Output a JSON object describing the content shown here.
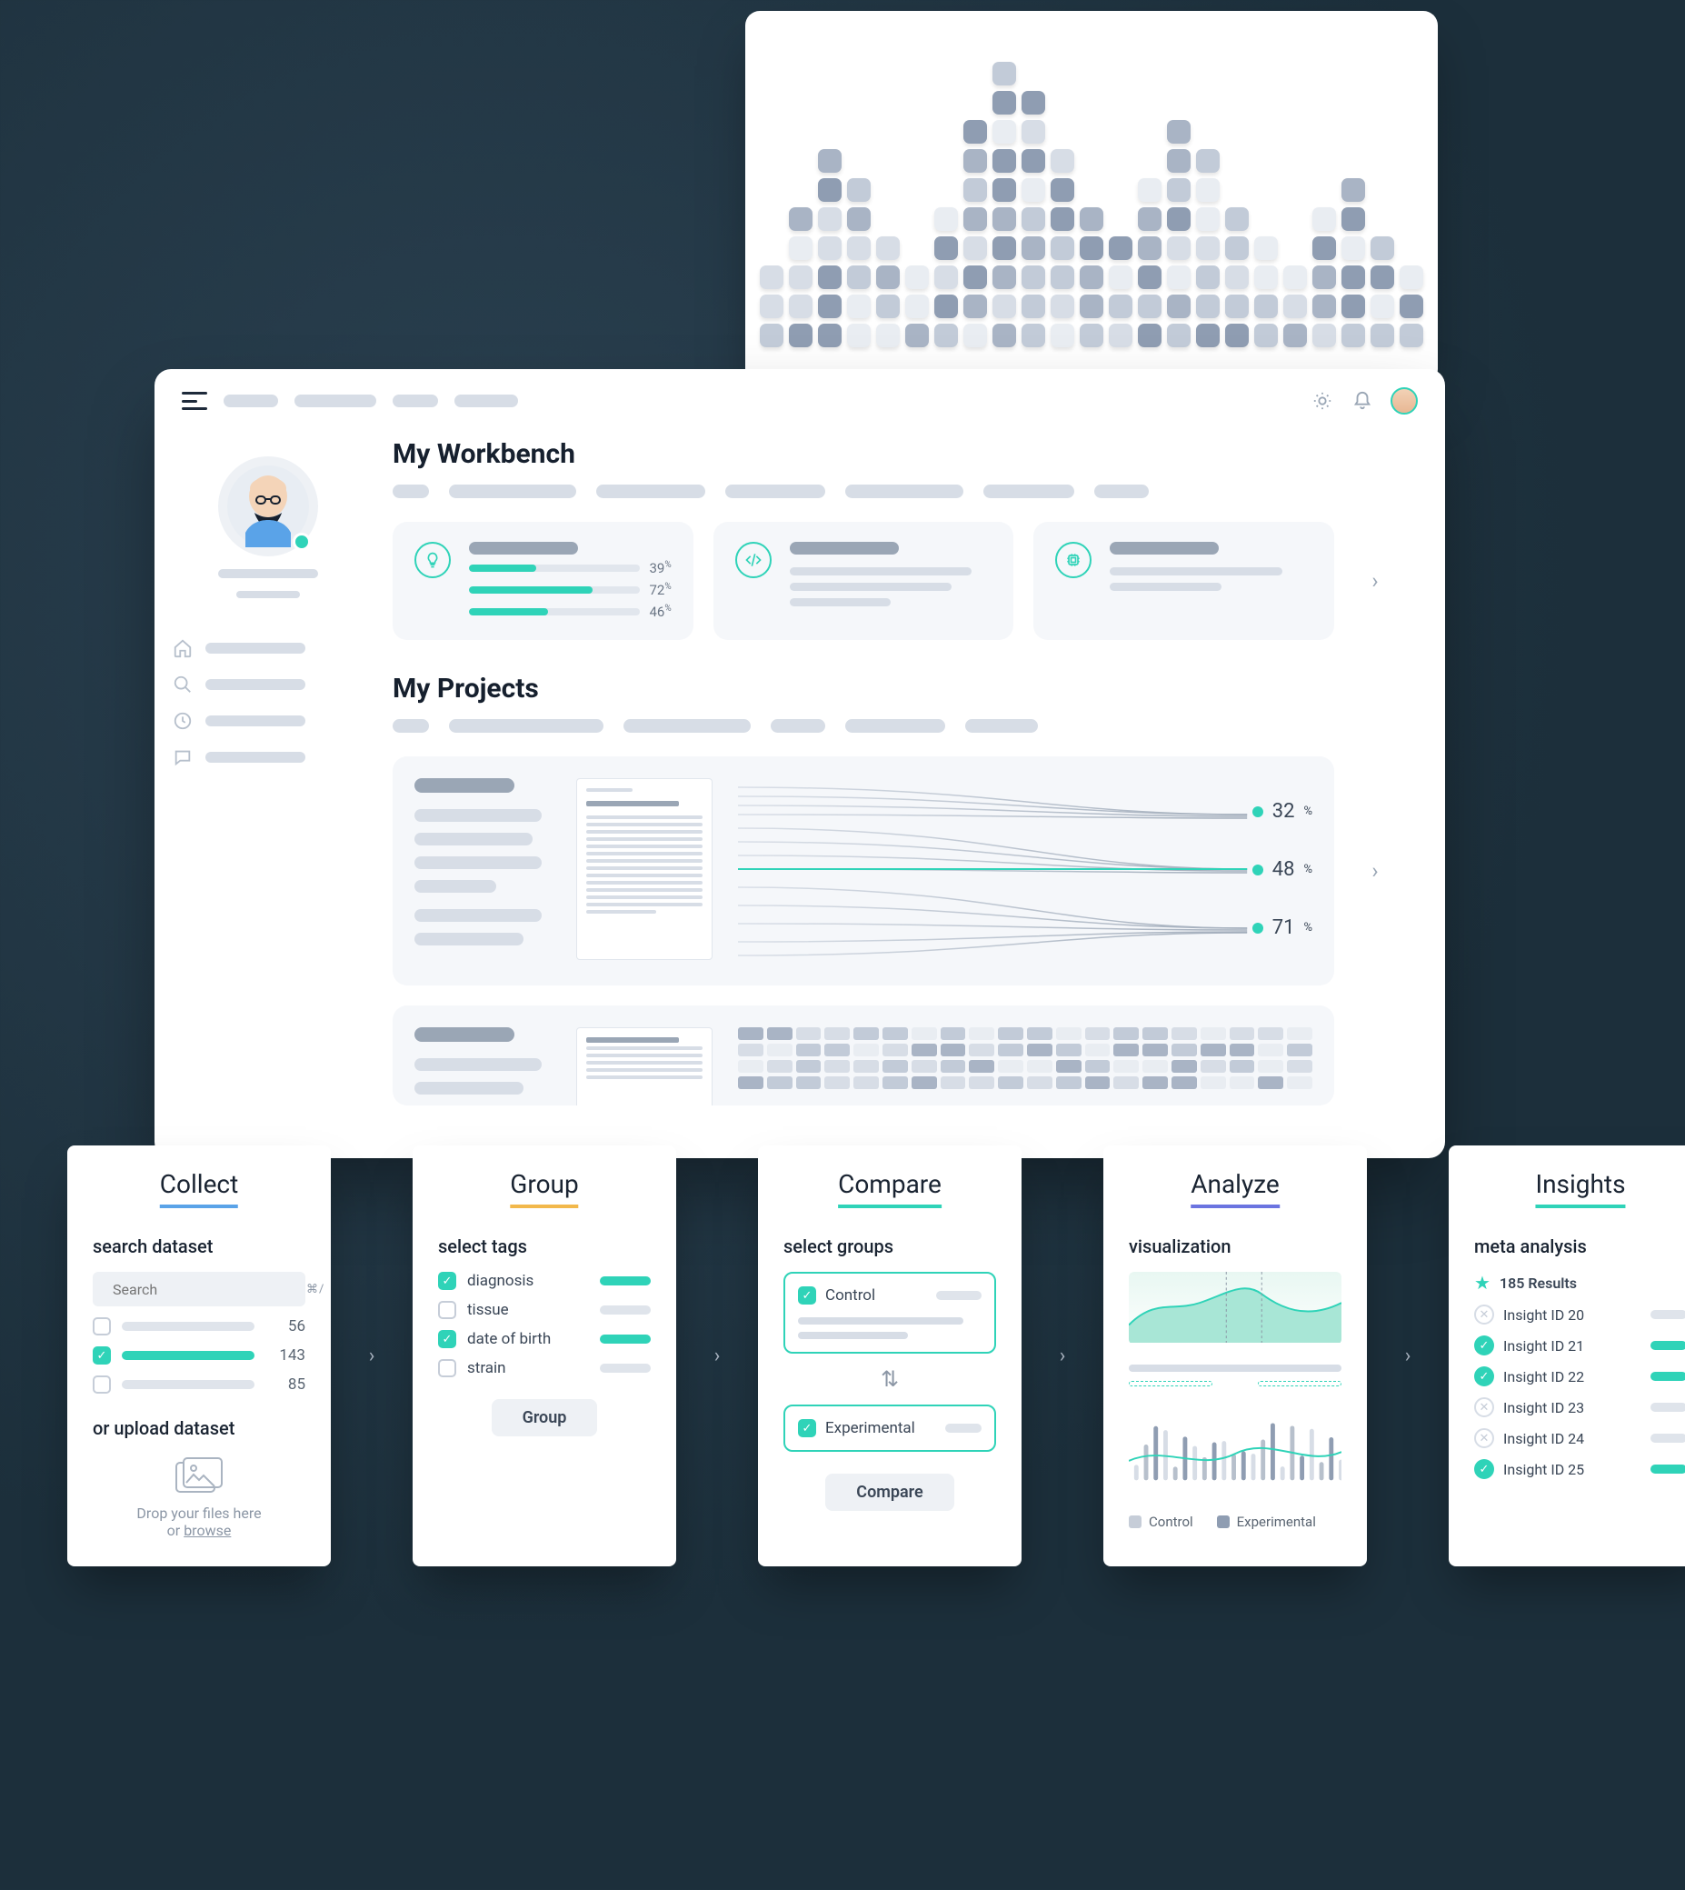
{
  "hero": {
    "columns": [
      3,
      5,
      7,
      6,
      4,
      3,
      5,
      8,
      10,
      9,
      7,
      5,
      4,
      6,
      8,
      7,
      5,
      4,
      3,
      5,
      6,
      4,
      3
    ],
    "palette": [
      "#e9edf2",
      "#d7dde6",
      "#c2cbd8",
      "#a9b4c5",
      "#8f9db2"
    ]
  },
  "app": {
    "workbench_title": "My Workbench",
    "projects_title": "My Projects",
    "stat_cards": [
      {
        "icon": "bulb",
        "bars": [
          {
            "pct": 39,
            "label": "39"
          },
          {
            "pct": 72,
            "label": "72"
          },
          {
            "pct": 46,
            "label": "46"
          }
        ]
      },
      {
        "icon": "code"
      },
      {
        "icon": "chip"
      }
    ],
    "project_metrics": [
      {
        "v": "32"
      },
      {
        "v": "48"
      },
      {
        "v": "71"
      }
    ]
  },
  "wf": {
    "collect": {
      "title": "Collect",
      "sub1": "search dataset",
      "sub2": "or upload dataset",
      "search_placeholder": "Search",
      "shortcut": "⌘/",
      "rows": [
        {
          "checked": false,
          "count": "56"
        },
        {
          "checked": true,
          "count": "143"
        },
        {
          "checked": false,
          "count": "85"
        }
      ],
      "drop_text": "Drop your files here",
      "browse": "browse",
      "or": "or "
    },
    "group": {
      "title": "Group",
      "sub": "select tags",
      "tags": [
        {
          "name": "diagnosis",
          "checked": true
        },
        {
          "name": "tissue",
          "checked": false
        },
        {
          "name": "date of birth",
          "checked": true
        },
        {
          "name": "strain",
          "checked": false
        }
      ],
      "btn": "Group"
    },
    "compare": {
      "title": "Compare",
      "sub": "select groups",
      "g1": "Control",
      "g2": "Experimental",
      "btn": "Compare"
    },
    "analyze": {
      "title": "Analyze",
      "sub": "visualization",
      "legend1": "Control",
      "legend2": "Experimental"
    },
    "insights": {
      "title": "Insights",
      "sub": "meta analysis",
      "results": "185 Results",
      "items": [
        {
          "id": "Insight ID 20",
          "ok": false
        },
        {
          "id": "Insight ID 21",
          "ok": true
        },
        {
          "id": "Insight ID 22",
          "ok": true
        },
        {
          "id": "Insight ID 23",
          "ok": false
        },
        {
          "id": "Insight ID 24",
          "ok": false
        },
        {
          "id": "Insight ID 25",
          "ok": true
        }
      ]
    }
  },
  "colors": {
    "collect": "#5aa3e8",
    "group": "#f2b84b",
    "compare": "#2fd3b8",
    "analyze": "#6b74e0",
    "insights": "#2fd3b8"
  }
}
